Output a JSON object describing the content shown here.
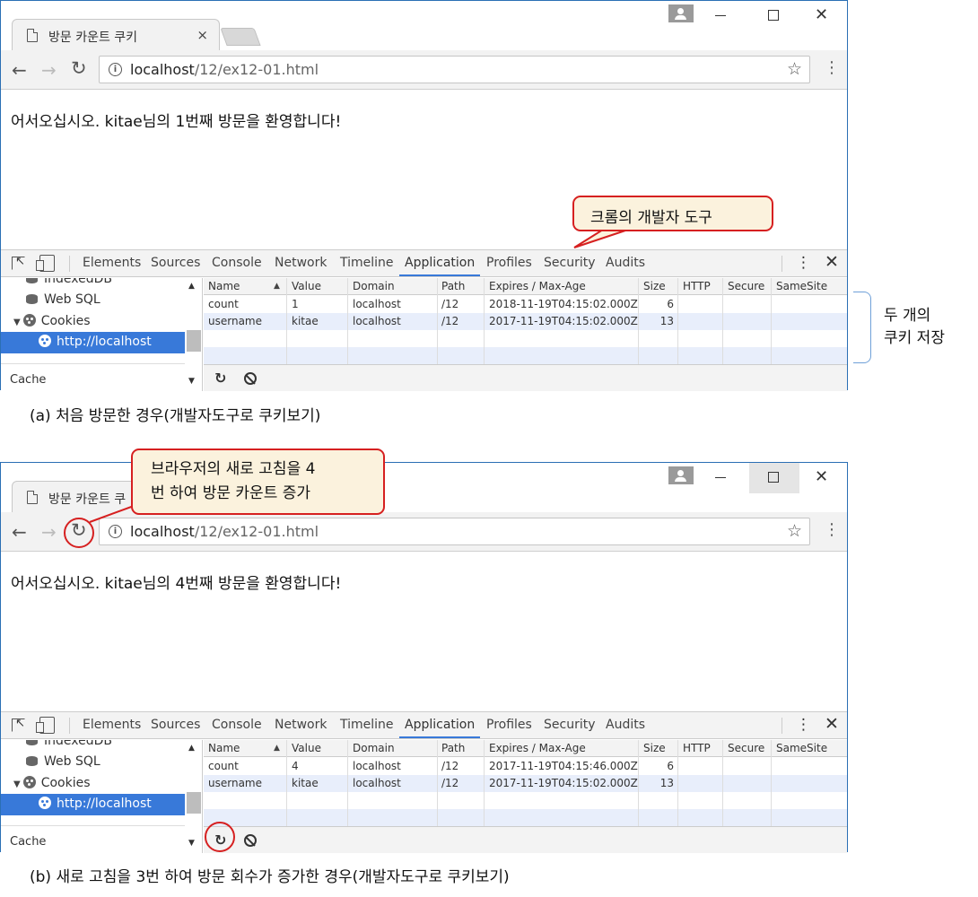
{
  "screens": [
    {
      "tab_title": "방문 카운트 쿠키",
      "tab_close": "×",
      "url_host": "localhost",
      "url_path": "/12/ex12-01.html",
      "greeting": "어서오십시오. kitae님의 1번째 방문을 환영합니다!",
      "caption": "(a) 처음 방문한 경우(개발자도구로 쿠키보기)",
      "cookies": [
        {
          "name": "count",
          "value": "1",
          "domain": "localhost",
          "path": "/12",
          "expires": "2018-11-19T04:15:02.000Z",
          "size": "6"
        },
        {
          "name": "username",
          "value": "kitae",
          "domain": "localhost",
          "path": "/12",
          "expires": "2017-11-19T04:15:02.000Z",
          "size": "13"
        }
      ]
    },
    {
      "tab_title": "방문 카운트 쿠",
      "tab_close": "",
      "url_host": "localhost",
      "url_path": "/12/ex12-01.html",
      "greeting": "어서오십시오. kitae님의 4번째 방문을 환영합니다!",
      "caption": "(b) 새로 고침을 3번 하여 방문 회수가 증가한 경우(개발자도구로 쿠키보기)",
      "cookies": [
        {
          "name": "count",
          "value": "4",
          "domain": "localhost",
          "path": "/12",
          "expires": "2017-11-19T04:15:46.000Z",
          "size": "6"
        },
        {
          "name": "username",
          "value": "kitae",
          "domain": "localhost",
          "path": "/12",
          "expires": "2017-11-19T04:15:02.000Z",
          "size": "13"
        }
      ]
    }
  ],
  "devtools": {
    "tabs": [
      "Elements",
      "Sources",
      "Console",
      "Network",
      "Timeline",
      "Application",
      "Profiles",
      "Security",
      "Audits"
    ],
    "active_tab": "Application",
    "sidebar": {
      "indexeddb": "IndexedDB",
      "websql": "Web SQL",
      "cookies": "Cookies",
      "cookie_host": "http://localhost",
      "cache": "Cache"
    },
    "columns": {
      "name": "Name",
      "value": "Value",
      "domain": "Domain",
      "path": "Path",
      "expires": "Expires / Max-Age",
      "size": "Size",
      "http": "HTTP",
      "secure": "Secure",
      "samesite": "SameSite"
    }
  },
  "annotations": {
    "devtools_callout": "크롬의 개발자 도구",
    "two_cookies_line1": "두 개의",
    "two_cookies_line2": "쿠키 저장",
    "reload_callout_line1": "브라우저의 새로 고침을 4",
    "reload_callout_line2": "번 하여 방문 카운트 증가"
  },
  "colors": {
    "window_border": "#2b6fb4",
    "selection_blue": "#3879d9",
    "callout_bg": "#fbf2dd",
    "callout_border": "#d62020",
    "alt_row": "#e8eefb"
  },
  "icons": [
    "document-icon",
    "back-arrow-icon",
    "forward-arrow-icon",
    "reload-icon",
    "info-icon",
    "star-icon",
    "kebab-menu-icon",
    "profile-icon",
    "inspect-icon",
    "device-icon",
    "database-icon",
    "cookie-icon",
    "refresh-icon",
    "block-icon"
  ]
}
